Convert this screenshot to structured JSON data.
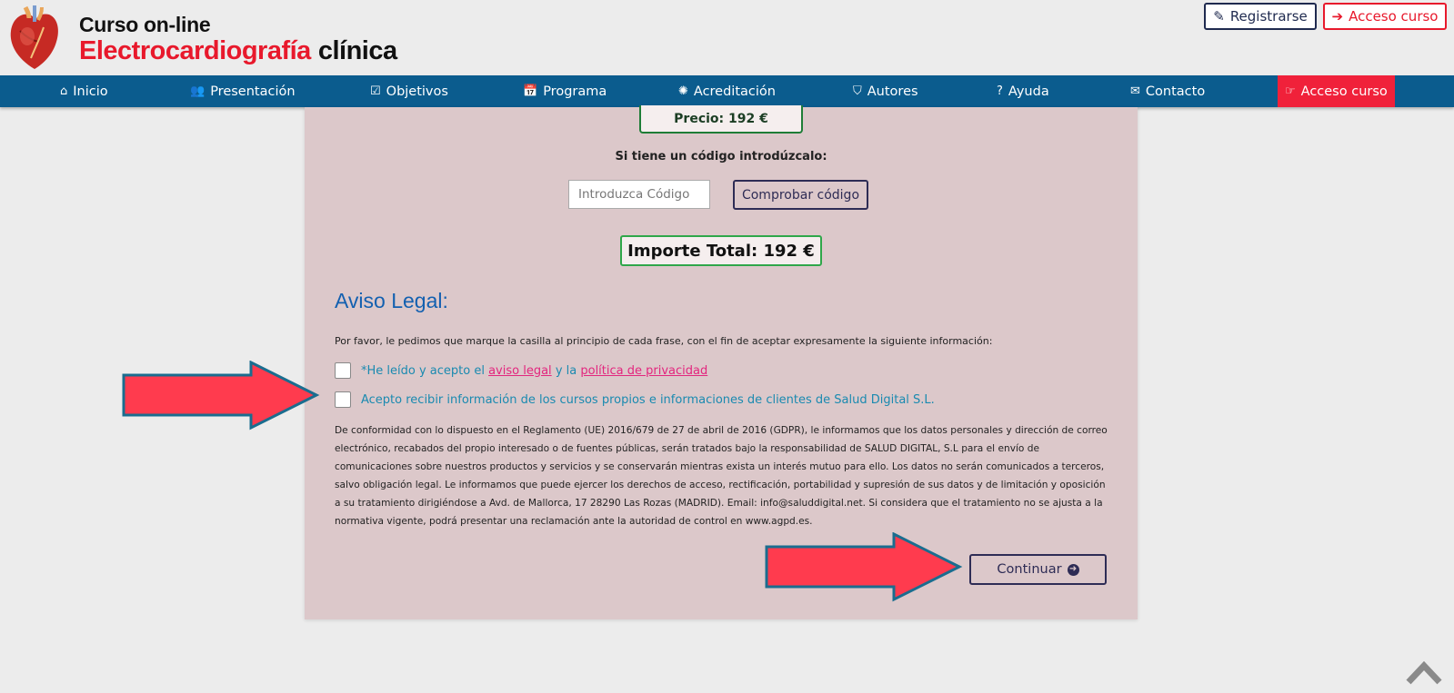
{
  "header": {
    "logo_line1": "Curso on-line",
    "logo_line2_red": "Electrocardiografía",
    "logo_line2_black": "clínica",
    "register_label": "Registrarse",
    "access_label": "Acceso curso"
  },
  "nav": {
    "items": [
      {
        "label": "Inicio",
        "icon": "home-icon"
      },
      {
        "label": "Presentación",
        "icon": "users-icon"
      },
      {
        "label": "Objetivos",
        "icon": "check-square-icon"
      },
      {
        "label": "Programa",
        "icon": "calendar-check-icon"
      },
      {
        "label": "Acreditación",
        "icon": "certificate-icon"
      },
      {
        "label": "Autores",
        "icon": "shield-icon"
      },
      {
        "label": "Ayuda",
        "icon": "question-circle-icon"
      },
      {
        "label": "Contacto",
        "icon": "envelope-icon"
      },
      {
        "label": "Acceso curso",
        "icon": "hand-point-right-icon"
      }
    ]
  },
  "price": {
    "label": "Precio: 192 €"
  },
  "code": {
    "prompt": "Si tiene un código introdúzcalo:",
    "placeholder": "Introduzca Código",
    "check_button": "Comprobar código"
  },
  "total": {
    "label": "Importe Total: 192 €"
  },
  "legal": {
    "title": "Aviso Legal:",
    "intro": "Por favor, le pedimos que marque la casilla al principio de cada frase, con el fin de aceptar expresamente la siguiente información:",
    "check1_prefix": "*He leído y acepto el",
    "check1_link1": "aviso legal",
    "check1_mid": "y la",
    "check1_link2": "política de privacidad",
    "check2_text": "Acepto recibir información de los cursos propios e informaciones de clientes de Salud Digital S.L.",
    "body": "De conformidad con lo dispuesto en el Reglamento (UE) 2016/679 de 27 de abril de 2016 (GDPR), le informamos que los datos personales y dirección de correo electrónico, recabados del propio interesado o de fuentes públicas, serán tratados bajo la responsabilidad de SALUD DIGITAL, S.L para el envío de comunicaciones sobre nuestros productos y servicios y se conservarán mientras exista un interés mutuo para ello. Los datos no serán comunicados a terceros, salvo obligación legal. Le informamos que puede ejercer los derechos de acceso, rectificación, portabilidad y supresión de sus datos y de limitación y oposición a su tratamiento dirigiéndose a Avd. de Mallorca, 17 28290 Las Rozas (MADRID). Email: info@saluddigital.net. Si considera que el tratamiento no se ajusta a la normativa vigente, podrá presentar una reclamación ante la autoridad de control en www.agpd.es.",
    "continue_label": "Continuar"
  },
  "colors": {
    "nav_bg": "#0b5c8e",
    "accent_red": "#f0213a",
    "panel_bg": "#dcc8ca",
    "title_blue": "#1360b0"
  }
}
